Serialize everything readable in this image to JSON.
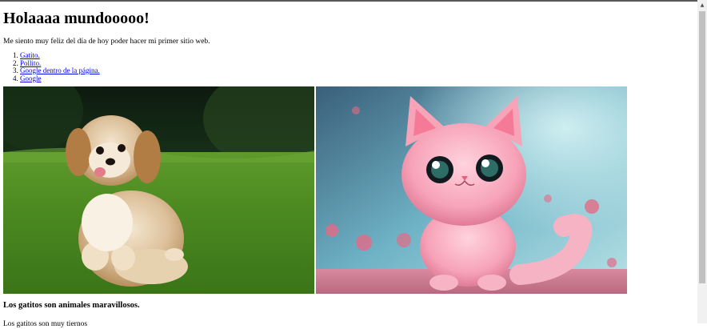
{
  "page": {
    "heading": "Holaaaa mundooooo!",
    "intro": "Me siento muy feliz del día de hoy poder hacer mi primer sitio web.",
    "links": [
      {
        "label": "Gatito."
      },
      {
        "label": "Pollito."
      },
      {
        "label": "Google dentro de la página."
      },
      {
        "label": "Google"
      }
    ],
    "images": [
      {
        "name": "puppy-photo",
        "alt": "Perrito"
      },
      {
        "name": "kitten-illustration",
        "alt": "Gatito"
      }
    ],
    "caption": "Los gatitos son animales maravillosos.",
    "cut_text": "Los gatitos son muy tiernos"
  },
  "scrollbar": {
    "up_icon": "triangle-up-icon"
  },
  "colors": {
    "link": "#0000ee",
    "scroll_thumb": "#c1c1c1",
    "scroll_track": "#f1f1f1"
  }
}
